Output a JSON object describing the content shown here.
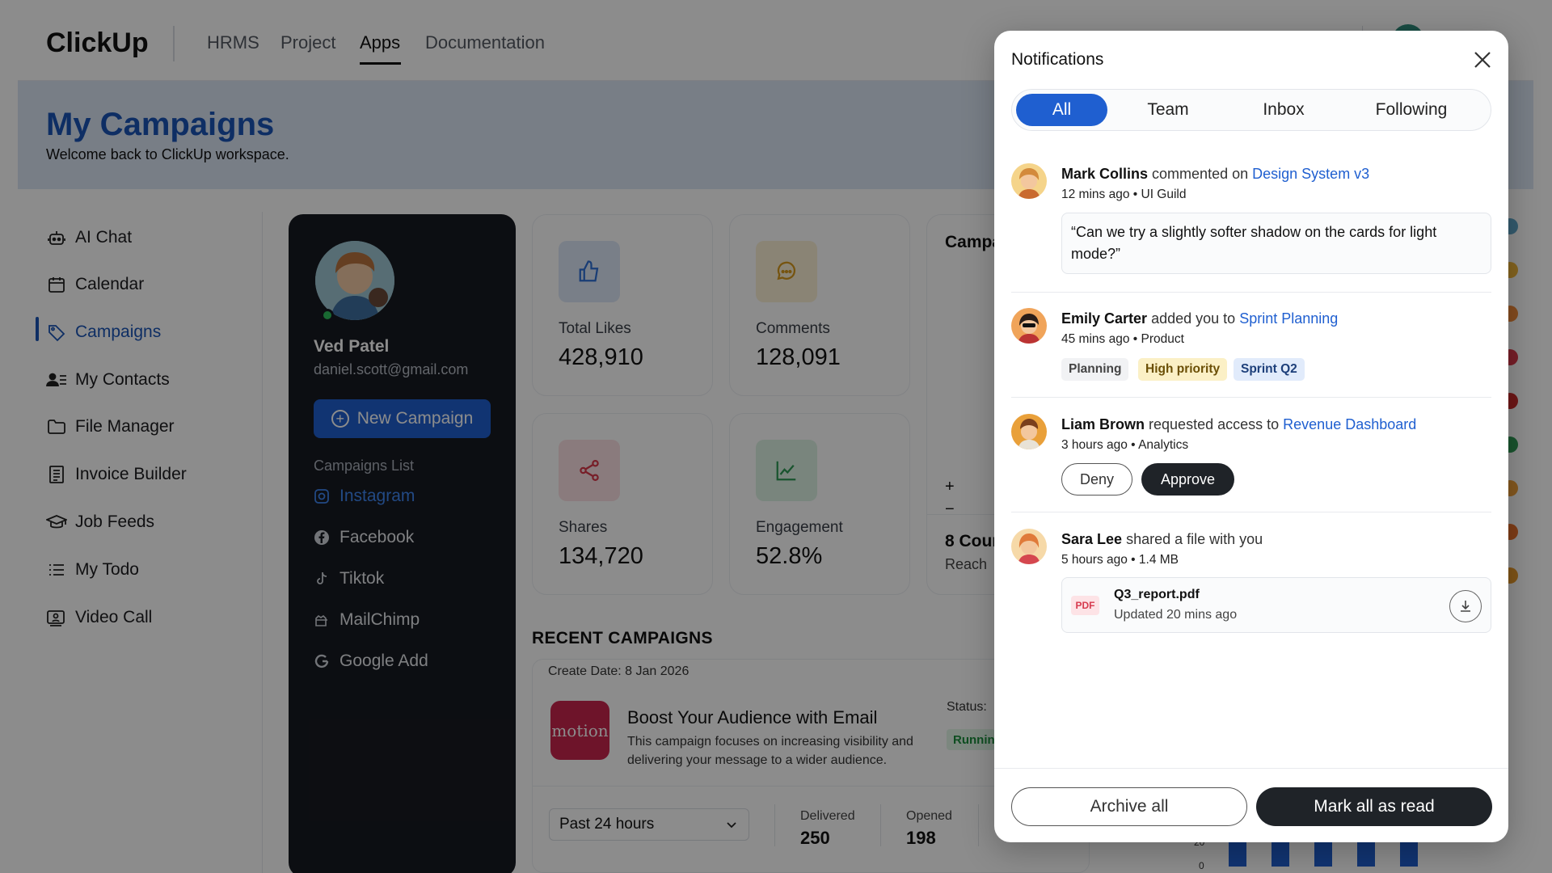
{
  "header": {
    "logo": "ClickUp",
    "nav": [
      "HRMS",
      "Project",
      "Apps",
      "Documentation"
    ],
    "active_nav": "Apps"
  },
  "banner": {
    "title": "My Campaigns",
    "subtitle": "Welcome back to ClickUp workspace."
  },
  "sidebar": {
    "items": [
      {
        "label": "AI Chat",
        "icon": "robot-icon"
      },
      {
        "label": "Calendar",
        "icon": "calendar-icon"
      },
      {
        "label": "Campaigns",
        "icon": "tag-icon",
        "active": true
      },
      {
        "label": "My Contacts",
        "icon": "contacts-icon"
      },
      {
        "label": "File Manager",
        "icon": "folder-icon"
      },
      {
        "label": "Invoice Builder",
        "icon": "invoice-icon"
      },
      {
        "label": "Job Feeds",
        "icon": "graduation-cap-icon"
      },
      {
        "label": "My Todo",
        "icon": "list-icon"
      },
      {
        "label": "Video Call",
        "icon": "video-call-icon"
      }
    ]
  },
  "profile": {
    "name": "Ved Patel",
    "email": "daniel.scott@gmail.com",
    "new_campaign_label": "New Campaign",
    "campaigns_list_label": "Campaigns List",
    "campaigns": [
      {
        "label": "Instagram",
        "icon": "instagram-icon",
        "active": true
      },
      {
        "label": "Facebook",
        "icon": "facebook-icon"
      },
      {
        "label": "Tiktok",
        "icon": "tiktok-icon"
      },
      {
        "label": "MailChimp",
        "icon": "mailchimp-icon"
      },
      {
        "label": "Google Add",
        "icon": "google-icon"
      }
    ]
  },
  "stats": [
    {
      "label": "Total Likes",
      "value": "428,910",
      "icon": "thumbs-up-icon",
      "color": "#2f6fd6",
      "bg": "#dde7f7"
    },
    {
      "label": "Comments",
      "value": "128,091",
      "icon": "comment-icon",
      "color": "#d79a1c",
      "bg": "#fbf0d6"
    },
    {
      "label": "Shares",
      "value": "134,720",
      "icon": "share-icon",
      "color": "#d9384a",
      "bg": "#fbe0e3"
    },
    {
      "label": "Engagement",
      "value": "52.8%",
      "icon": "trend-icon",
      "color": "#2e9a55",
      "bg": "#dcf2e3"
    }
  ],
  "campaign_chart_card": {
    "title": "Campa",
    "zoom_in": "+",
    "zoom_out": "−",
    "countries": "8 Cour",
    "reach": "Reach"
  },
  "recent": {
    "title": "RECENT CAMPAIGNS",
    "create_date": "Create Date: 8 Jan 2026",
    "logo_text": "motion",
    "campaign_title": "Boost Your Audience with Email",
    "campaign_desc": "This campaign focuses on increasing visibility and delivering your message to a wider audience.",
    "status_label": "Status:",
    "status_value": "Running",
    "time_range": "Past 24 hours",
    "metrics": [
      {
        "label": "Delivered",
        "value": "250"
      },
      {
        "label": "Opened",
        "value": "198"
      }
    ]
  },
  "mini_chart": {
    "tick_labels": [
      "20",
      "0"
    ]
  },
  "notifications": {
    "title": "Notifications",
    "tabs": [
      "All",
      "Team",
      "Inbox",
      "Following"
    ],
    "active_tab": "All",
    "items": [
      {
        "user": "Mark Collins",
        "action": "commented on",
        "target": "Design System v3",
        "time": "12 mins ago",
        "context": "UI Guild",
        "quote": "“Can we try a slightly softer shadow on the cards for light mode?”"
      },
      {
        "user": "Emily Carter",
        "action": "added you to",
        "target": "Sprint Planning",
        "time": "45 mins ago",
        "context": "Product",
        "tags": [
          "Planning",
          "High priority",
          "Sprint Q2"
        ]
      },
      {
        "user": "Liam Brown",
        "action": "requested access to",
        "target": "Revenue Dashboard",
        "time": "3 hours ago",
        "context": "Analytics",
        "deny_label": "Deny",
        "approve_label": "Approve"
      },
      {
        "user": "Sara Lee",
        "action": "shared a file with you",
        "target": "",
        "time": "5 hours ago",
        "context": "1.4 MB",
        "file": {
          "badge": "PDF",
          "name": "Q3_report.pdf",
          "updated": "Updated 20 mins ago"
        }
      }
    ],
    "archive_label": "Archive all",
    "mark_all_label": "Mark all as read"
  }
}
